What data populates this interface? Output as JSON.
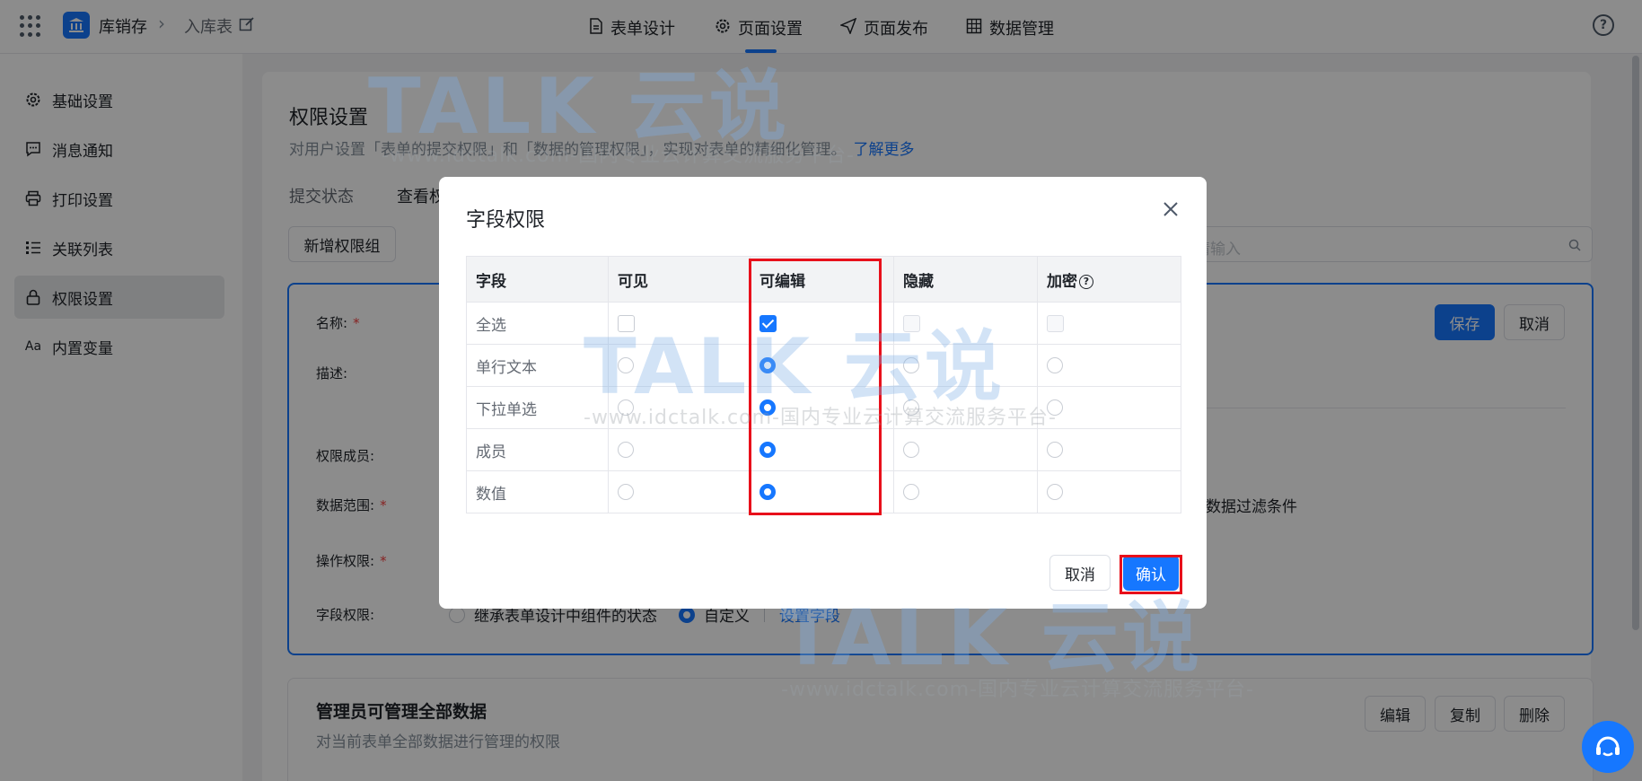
{
  "topbar": {
    "app_name": "库销存",
    "page_name": "入库表",
    "tabs": [
      {
        "label": "表单设计",
        "icon": "doc-icon"
      },
      {
        "label": "页面设置",
        "icon": "gear-icon",
        "active": true
      },
      {
        "label": "页面发布",
        "icon": "send-icon"
      },
      {
        "label": "数据管理",
        "icon": "table-icon"
      }
    ],
    "help_glyph": "?"
  },
  "sidebar": {
    "items": [
      {
        "label": "基础设置",
        "icon": "gear-icon"
      },
      {
        "label": "消息通知",
        "icon": "message-icon"
      },
      {
        "label": "打印设置",
        "icon": "printer-icon"
      },
      {
        "label": "关联列表",
        "icon": "list-icon"
      },
      {
        "label": "权限设置",
        "icon": "lock-icon",
        "active": true
      },
      {
        "label": "内置变量",
        "icon": "text-icon",
        "icon_text": "Aa"
      }
    ]
  },
  "main": {
    "title": "权限设置",
    "desc": "对用户设置「表单的提交权限」和「数据的管理权限」，实现对表单的精细化管理。",
    "learn_more": "了解更多",
    "sub_tabs": [
      "提交状态",
      "查看权"
    ],
    "add_group_button": "新增权限组",
    "search_placeholder": "请输入",
    "group": {
      "name_label": "名称:",
      "desc_label": "描述:",
      "members_label": "权限成员:",
      "data_range_label": "数据范围:",
      "op_label": "操作权限:",
      "field_label": "字段权限:",
      "save_button": "保存",
      "cancel_button": "取消",
      "filter_text": "置数据过滤条件",
      "field_option_inherit": "继承表单设计中组件的状态",
      "field_option_custom": "自定义",
      "field_link": "设置字段"
    },
    "admin": {
      "title": "管理员可管理全部数据",
      "desc": "对当前表单全部数据进行管理的权限",
      "edit_button": "编辑",
      "copy_button": "复制",
      "delete_button": "删除"
    }
  },
  "modal": {
    "title": "字段权限",
    "columns": [
      "字段",
      "可见",
      "可编辑",
      "隐藏",
      "加密"
    ],
    "rows": [
      {
        "field": "全选",
        "selected": "可编辑",
        "kind": "checkbox"
      },
      {
        "field": "单行文本",
        "selected": "可编辑",
        "kind": "radio"
      },
      {
        "field": "下拉单选",
        "selected": "可编辑",
        "kind": "radio"
      },
      {
        "field": "成员",
        "selected": "可编辑",
        "kind": "radio"
      },
      {
        "field": "数值",
        "selected": "可编辑",
        "kind": "radio"
      }
    ],
    "cancel_button": "取消",
    "confirm_button": "确认"
  },
  "watermark": {
    "brand": "TALK 云说",
    "url": "-www.idctalk.com-国内专业云计算交流服务平台-"
  },
  "colors": {
    "primary": "#1677ff",
    "highlight": "#e8101b",
    "danger": "#f53f3f"
  }
}
